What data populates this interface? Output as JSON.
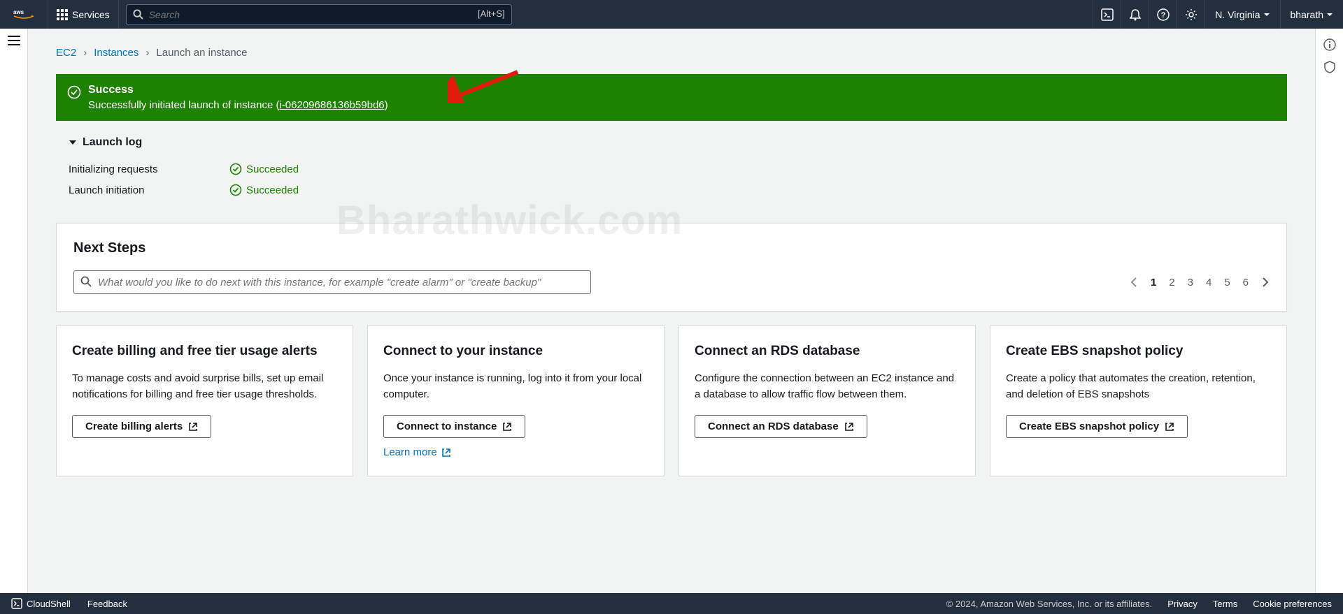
{
  "topbar": {
    "services_label": "Services",
    "search_placeholder": "Search",
    "search_shortcut": "[Alt+S]",
    "region": "N. Virginia",
    "account": "bharath"
  },
  "breadcrumbs": {
    "items": [
      "EC2",
      "Instances",
      "Launch an instance"
    ]
  },
  "banner": {
    "title": "Success",
    "message_prefix": "Successfully initiated launch of instance (",
    "instance_id": "i-06209686136b59bd6",
    "message_suffix": ")"
  },
  "launch_log": {
    "title": "Launch log",
    "rows": [
      {
        "label": "Initializing requests",
        "status": "Succeeded"
      },
      {
        "label": "Launch initiation",
        "status": "Succeeded"
      }
    ]
  },
  "next_steps": {
    "title": "Next Steps",
    "search_placeholder": "What would you like to do next with this instance, for example \"create alarm\" or \"create backup\"",
    "pages": [
      "1",
      "2",
      "3",
      "4",
      "5",
      "6"
    ],
    "active_page": "1",
    "cards": [
      {
        "title": "Create billing and free tier usage alerts",
        "desc": "To manage costs and avoid surprise bills, set up email notifications for billing and free tier usage thresholds.",
        "button": "Create billing alerts"
      },
      {
        "title": "Connect to your instance",
        "desc": "Once your instance is running, log into it from your local computer.",
        "button": "Connect to instance",
        "link": "Learn more"
      },
      {
        "title": "Connect an RDS database",
        "desc": "Configure the connection between an EC2 instance and a database to allow traffic flow between them.",
        "button": "Connect an RDS database"
      },
      {
        "title": "Create EBS snapshot policy",
        "desc": "Create a policy that automates the creation, retention, and deletion of EBS snapshots",
        "button": "Create EBS snapshot policy"
      }
    ]
  },
  "footer": {
    "cloudshell": "CloudShell",
    "feedback": "Feedback",
    "copyright": "© 2024, Amazon Web Services, Inc. or its affiliates.",
    "links": [
      "Privacy",
      "Terms",
      "Cookie preferences"
    ]
  },
  "watermark": "Bharathwick.com"
}
